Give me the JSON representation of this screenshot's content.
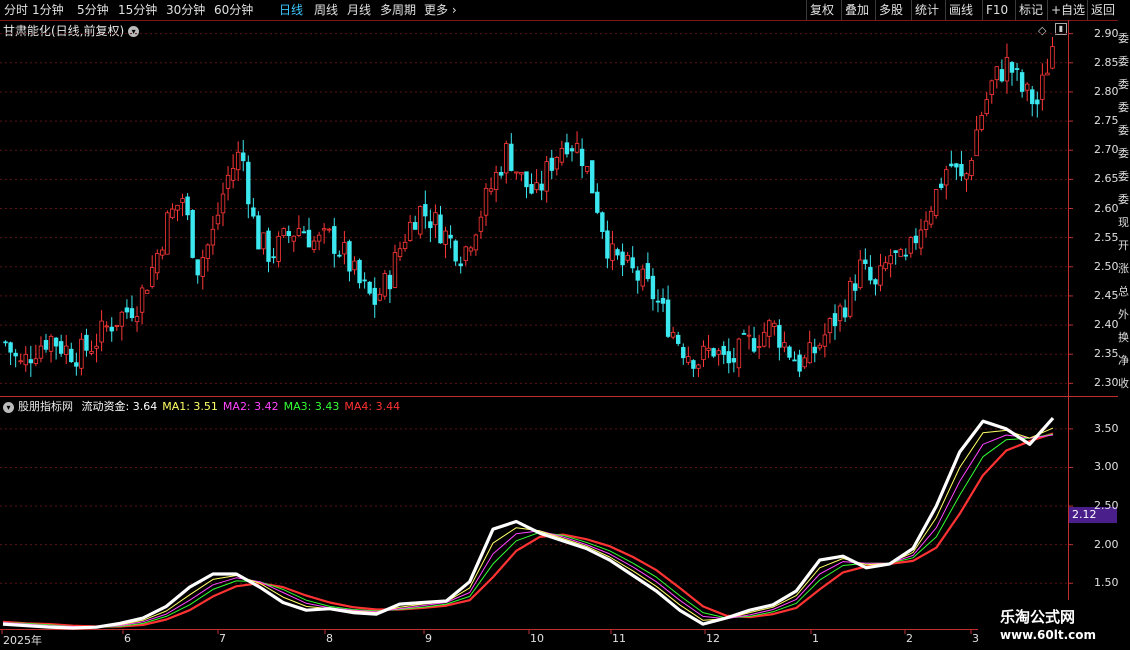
{
  "toolbar": {
    "periods": [
      "分时",
      "1分钟",
      "5分钟",
      "15分钟",
      "30分钟",
      "60分钟",
      "日线",
      "周线",
      "月线",
      "多周期",
      "更多"
    ],
    "active_period": "日线",
    "right_buttons": [
      "复权",
      "叠加",
      "多股",
      "统计",
      "画线",
      "F10",
      "标记",
      "+自选",
      "返回"
    ]
  },
  "main_chart": {
    "title": "甘肃能化(日线,前复权)",
    "y_ticks": [
      "2.90",
      "2.85",
      "2.80",
      "2.75",
      "2.70",
      "2.65",
      "2.60",
      "2.55",
      "2.50",
      "2.45",
      "2.40",
      "2.35",
      "2.30"
    ],
    "y_values": [
      2.9,
      2.85,
      2.8,
      2.75,
      2.7,
      2.65,
      2.6,
      2.55,
      2.5,
      2.45,
      2.4,
      2.35,
      2.3
    ],
    "side_chars": "委委委委委委委委现开涨总外换净收",
    "up_color": "#ff3838",
    "down_color": "#3ce8f0"
  },
  "indicator": {
    "name": "股朋指标网",
    "items": [
      {
        "label": "流动资金: 3.64",
        "color": "#ffffff"
      },
      {
        "label": "MA1: 3.51",
        "color": "#ffff66"
      },
      {
        "label": "MA2: 3.42",
        "color": "#ff44ff"
      },
      {
        "label": "MA3: 3.43",
        "color": "#33ff33"
      },
      {
        "label": "MA4: 3.44",
        "color": "#ff3333"
      }
    ],
    "y_ticks": [
      "3.50",
      "3.00",
      "2.50",
      "2.00",
      "1.50"
    ],
    "y_values": [
      3.5,
      3.0,
      2.5,
      2.0,
      1.5
    ],
    "price_tag": "2.12"
  },
  "x_axis": {
    "labels": [
      "2025年",
      "6",
      "7",
      "8",
      "9",
      "10",
      "11",
      "12",
      "1",
      "2",
      "3"
    ]
  },
  "watermark": {
    "line1": "乐淘公式网",
    "line2": "www.60lt.com"
  },
  "chart_data": [
    {
      "type": "candlestick",
      "title": "甘肃能化(日线,前复权)",
      "ylim": [
        2.28,
        2.92
      ],
      "x_labels": [
        "2025年",
        "6",
        "7",
        "8",
        "9",
        "10",
        "11",
        "12",
        "1",
        "2",
        "3"
      ],
      "close_path": [
        2.37,
        2.33,
        2.36,
        2.38,
        2.36,
        2.35,
        2.37,
        2.4,
        2.42,
        2.44,
        2.5,
        2.58,
        2.62,
        2.5,
        2.55,
        2.65,
        2.7,
        2.55,
        2.52,
        2.55,
        2.57,
        2.54,
        2.55,
        2.52,
        2.47,
        2.44,
        2.48,
        2.55,
        2.6,
        2.58,
        2.55,
        2.52,
        2.58,
        2.64,
        2.7,
        2.65,
        2.62,
        2.68,
        2.72,
        2.7,
        2.62,
        2.52,
        2.5,
        2.48,
        2.45,
        2.4,
        2.36,
        2.34,
        2.36,
        2.33,
        2.36,
        2.38,
        2.4,
        2.36,
        2.33,
        2.36,
        2.4,
        2.44,
        2.5,
        2.46,
        2.52,
        2.5,
        2.57,
        2.62,
        2.68,
        2.64,
        2.75,
        2.82,
        2.85,
        2.8,
        2.78,
        2.88
      ]
    },
    {
      "type": "line",
      "title": "股朋指标网",
      "ylim": [
        0.92,
        3.9
      ],
      "series": [
        {
          "name": "流动资金",
          "color": "#ffffff",
          "values": [
            0.97,
            0.95,
            0.93,
            0.92,
            0.93,
            0.98,
            1.05,
            1.2,
            1.45,
            1.62,
            1.62,
            1.45,
            1.25,
            1.15,
            1.17,
            1.12,
            1.1,
            1.23,
            1.25,
            1.27,
            1.52,
            2.2,
            2.3,
            2.15,
            2.05,
            1.95,
            1.8,
            1.6,
            1.4,
            1.15,
            0.97,
            1.05,
            1.15,
            1.22,
            1.4,
            1.8,
            1.85,
            1.7,
            1.75,
            1.95,
            2.5,
            3.2,
            3.6,
            3.5,
            3.3,
            3.64
          ]
        },
        {
          "name": "MA1",
          "color": "#ffff66",
          "values": [
            0.98,
            0.96,
            0.94,
            0.93,
            0.93,
            0.96,
            1.02,
            1.14,
            1.35,
            1.55,
            1.6,
            1.5,
            1.32,
            1.2,
            1.17,
            1.14,
            1.12,
            1.19,
            1.23,
            1.26,
            1.44,
            2.02,
            2.22,
            2.18,
            2.08,
            1.98,
            1.84,
            1.66,
            1.46,
            1.22,
            1.02,
            1.04,
            1.12,
            1.19,
            1.34,
            1.7,
            1.82,
            1.74,
            1.76,
            1.9,
            2.35,
            3.0,
            3.45,
            3.48,
            3.38,
            3.51
          ]
        },
        {
          "name": "MA2",
          "color": "#ff44ff",
          "values": [
            0.99,
            0.97,
            0.95,
            0.94,
            0.93,
            0.95,
            1.0,
            1.1,
            1.28,
            1.48,
            1.57,
            1.52,
            1.38,
            1.24,
            1.18,
            1.15,
            1.13,
            1.17,
            1.21,
            1.25,
            1.38,
            1.88,
            2.14,
            2.18,
            2.1,
            2.0,
            1.88,
            1.71,
            1.52,
            1.28,
            1.07,
            1.04,
            1.09,
            1.16,
            1.29,
            1.62,
            1.78,
            1.76,
            1.76,
            1.86,
            2.22,
            2.82,
            3.3,
            3.42,
            3.38,
            3.42
          ]
        },
        {
          "name": "MA3",
          "color": "#33ff33",
          "values": [
            0.99,
            0.98,
            0.96,
            0.94,
            0.93,
            0.94,
            0.98,
            1.07,
            1.22,
            1.42,
            1.53,
            1.52,
            1.42,
            1.28,
            1.2,
            1.16,
            1.14,
            1.16,
            1.19,
            1.23,
            1.33,
            1.75,
            2.05,
            2.16,
            2.12,
            2.03,
            1.92,
            1.76,
            1.58,
            1.34,
            1.12,
            1.05,
            1.07,
            1.13,
            1.24,
            1.54,
            1.73,
            1.76,
            1.76,
            1.83,
            2.1,
            2.64,
            3.14,
            3.36,
            3.38,
            3.43
          ]
        },
        {
          "name": "MA4",
          "color": "#ff3333",
          "values": [
            1.0,
            0.98,
            0.97,
            0.95,
            0.94,
            0.94,
            0.96,
            1.03,
            1.15,
            1.33,
            1.46,
            1.5,
            1.45,
            1.34,
            1.25,
            1.19,
            1.16,
            1.16,
            1.18,
            1.21,
            1.28,
            1.58,
            1.92,
            2.1,
            2.13,
            2.07,
            1.98,
            1.84,
            1.67,
            1.44,
            1.2,
            1.08,
            1.06,
            1.1,
            1.18,
            1.42,
            1.64,
            1.72,
            1.75,
            1.79,
            1.96,
            2.4,
            2.9,
            3.22,
            3.34,
            3.44
          ]
        }
      ]
    }
  ]
}
